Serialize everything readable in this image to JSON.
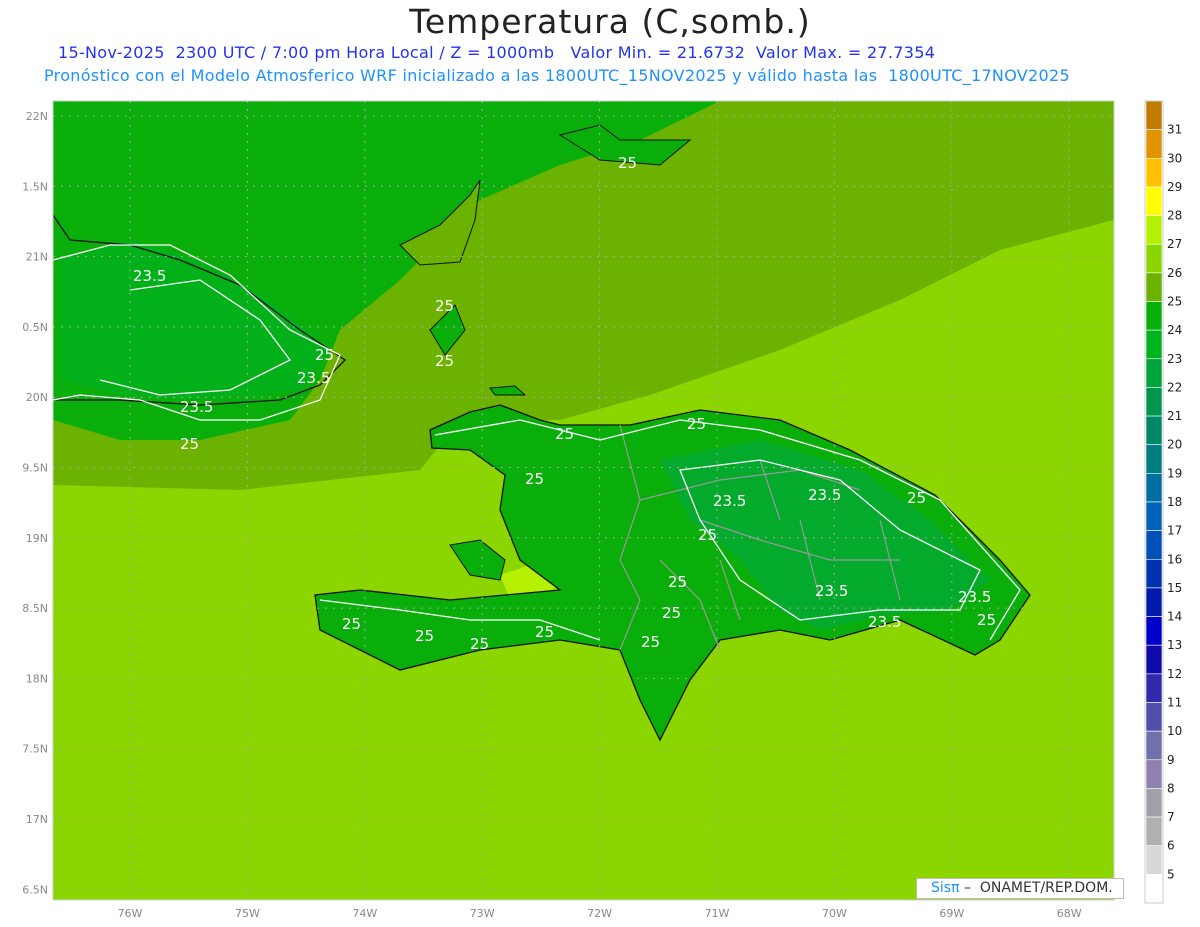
{
  "title": "Temperatura (C,somb.)",
  "subtitle1": "15-Nov-2025  2300 UTC / 7:00 pm Hora Local / Z = 1000mb   Valor Min. = 21.6732  Valor Max. = 27.7354",
  "subtitle2": "Pronóstico con el Modelo Atmosferico WRF inicializado a las 1800UTC_15NOV2025 y válido hasta las  1800UTC_17NOV2025",
  "map": {
    "variable": "Temperatura",
    "units": "C",
    "level": "1000mb",
    "value_min": 21.6732,
    "value_max": 27.7354,
    "lon_range": [
      -76.65,
      -67.6
    ],
    "lat_range": [
      17.4,
      22.1
    ],
    "lat_ticks": [
      "22N",
      "1.5N",
      "21N",
      "0.5N",
      "20N",
      "9.5N",
      "19N",
      "8.5N",
      "18N",
      "7.5N",
      "17N",
      "6.5N"
    ],
    "lat_values": [
      22,
      21.5,
      21,
      20.5,
      20,
      19.5,
      19,
      18.5,
      18,
      17.5,
      17,
      16.5
    ],
    "lon_ticks": [
      "76W",
      "75W",
      "74W",
      "73W",
      "72W",
      "71W",
      "70W",
      "69W",
      "68W"
    ],
    "lon_values": [
      -76,
      -75,
      -74,
      -73,
      -72,
      -71,
      -70,
      -69,
      -68
    ],
    "contour_labels": [
      "25",
      "23.5",
      "25",
      "25",
      "25",
      "23.5",
      "23.5",
      "25",
      "25",
      "25",
      "25",
      "25",
      "23.5",
      "23.5",
      "25",
      "25",
      "25",
      "25",
      "25",
      "25",
      "23.5",
      "23.5",
      "25",
      "25",
      "25"
    ],
    "colors": {
      "t24_25": "#0aae0a",
      "t25_26": "#6cb200",
      "t26_27": "#8cd600",
      "t27_28": "#b4f000",
      "t23_24": "#00b21e",
      "t22_23": "#00a33c"
    }
  },
  "colorbar": {
    "labels": [
      "31",
      "30",
      "29",
      "28",
      "27",
      "26",
      "25",
      "24",
      "23",
      "22",
      "21",
      "20",
      "19",
      "18",
      "17",
      "16",
      "15",
      "14",
      "13",
      "12",
      "11",
      "10",
      "9",
      "8",
      "7",
      "6",
      "5"
    ],
    "colors": [
      "#c07c00",
      "#e09400",
      "#ffc000",
      "#ffff00",
      "#b4f000",
      "#8cd600",
      "#6cb200",
      "#0aae0a",
      "#00b21e",
      "#00a33c",
      "#009650",
      "#00876a",
      "#007d80",
      "#006e9e",
      "#0062b8",
      "#0050b8",
      "#0032b0",
      "#001aaa",
      "#0000c8",
      "#100aaa",
      "#3228aa",
      "#5050aa",
      "#7070aa",
      "#9080b0",
      "#a0a0aa",
      "#b0b0b0",
      "#d8d8d8",
      "#ffffff"
    ]
  },
  "credit": {
    "brand": "Sisπ",
    "text": " –  ONAMET/REP.DOM."
  }
}
